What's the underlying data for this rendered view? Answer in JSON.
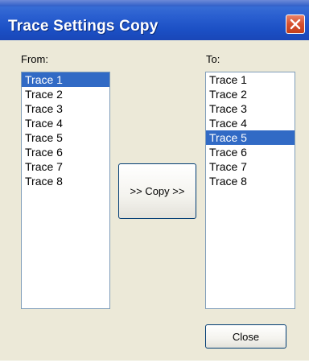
{
  "window": {
    "title": "Trace Settings Copy",
    "close_icon": "close-icon",
    "colors": {
      "title_bar": "#2a5fd0",
      "close_button": "#d6502e",
      "selection": "#316ac5",
      "background": "#ece9d8"
    }
  },
  "from": {
    "label": "From:",
    "items": [
      {
        "label": "Trace 1",
        "selected": true
      },
      {
        "label": "Trace 2",
        "selected": false
      },
      {
        "label": "Trace 3",
        "selected": false
      },
      {
        "label": "Trace 4",
        "selected": false
      },
      {
        "label": "Trace 5",
        "selected": false
      },
      {
        "label": "Trace 6",
        "selected": false
      },
      {
        "label": "Trace 7",
        "selected": false
      },
      {
        "label": "Trace 8",
        "selected": false
      }
    ]
  },
  "to": {
    "label": "To:",
    "items": [
      {
        "label": "Trace 1",
        "selected": false
      },
      {
        "label": "Trace 2",
        "selected": false
      },
      {
        "label": "Trace 3",
        "selected": false
      },
      {
        "label": "Trace 4",
        "selected": false
      },
      {
        "label": "Trace 5",
        "selected": true
      },
      {
        "label": "Trace 6",
        "selected": false
      },
      {
        "label": "Trace 7",
        "selected": false
      },
      {
        "label": "Trace 8",
        "selected": false
      }
    ]
  },
  "buttons": {
    "copy_label": ">> Copy >>",
    "close_label": "Close"
  }
}
